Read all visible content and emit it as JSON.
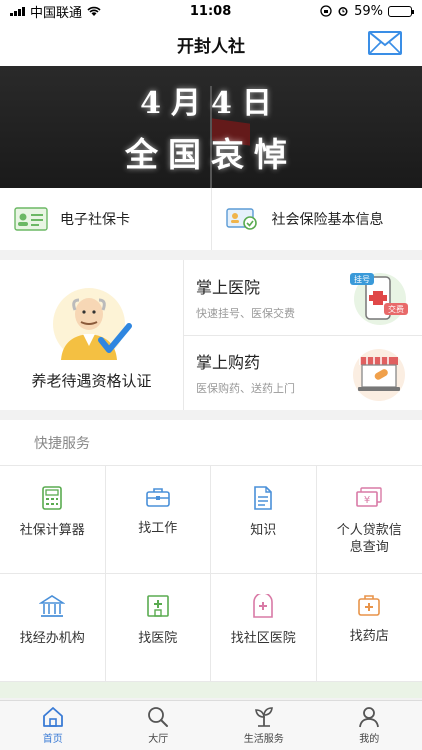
{
  "status": {
    "carrier": "中国联通",
    "time": "11:08",
    "battery": "59%",
    "battery_level": 0.59
  },
  "nav": {
    "title": "开封人社"
  },
  "banner": {
    "line1": "4月4日",
    "line2": "全国哀悼"
  },
  "cards": [
    {
      "label": "电子社保卡",
      "icon": "id-card-icon"
    },
    {
      "label": "社会保险基本信息",
      "icon": "insurance-info-icon"
    }
  ],
  "feature": {
    "main_label": "养老待遇资格认证",
    "items": [
      {
        "title": "掌上医院",
        "sub": "快速挂号、医保交费",
        "badge1": "挂号",
        "badge2": "交费"
      },
      {
        "title": "掌上购药",
        "sub": "医保购药、送药上门"
      }
    ]
  },
  "services": {
    "header": "快捷服务",
    "items": [
      {
        "label": "社保计算器",
        "icon": "calculator-icon"
      },
      {
        "label": "找工作",
        "icon": "briefcase-icon"
      },
      {
        "label": "知识",
        "icon": "document-icon"
      },
      {
        "label": "个人贷款信息查询",
        "icon": "loan-icon"
      },
      {
        "label": "找经办机构",
        "icon": "building-icon"
      },
      {
        "label": "找医院",
        "icon": "hospital-icon"
      },
      {
        "label": "找社区医院",
        "icon": "clinic-icon"
      },
      {
        "label": "找药店",
        "icon": "pharmacy-icon"
      }
    ]
  },
  "tabs": [
    {
      "label": "首页",
      "active": true
    },
    {
      "label": "大厅",
      "active": false
    },
    {
      "label": "生活服务",
      "active": false
    },
    {
      "label": "我的",
      "active": false
    }
  ],
  "colors": {
    "accent": "#3a7bd5",
    "icon_green": "#5aab50",
    "icon_blue": "#4a90d9",
    "icon_orange": "#e8944a",
    "icon_pink": "#d97aa6"
  }
}
